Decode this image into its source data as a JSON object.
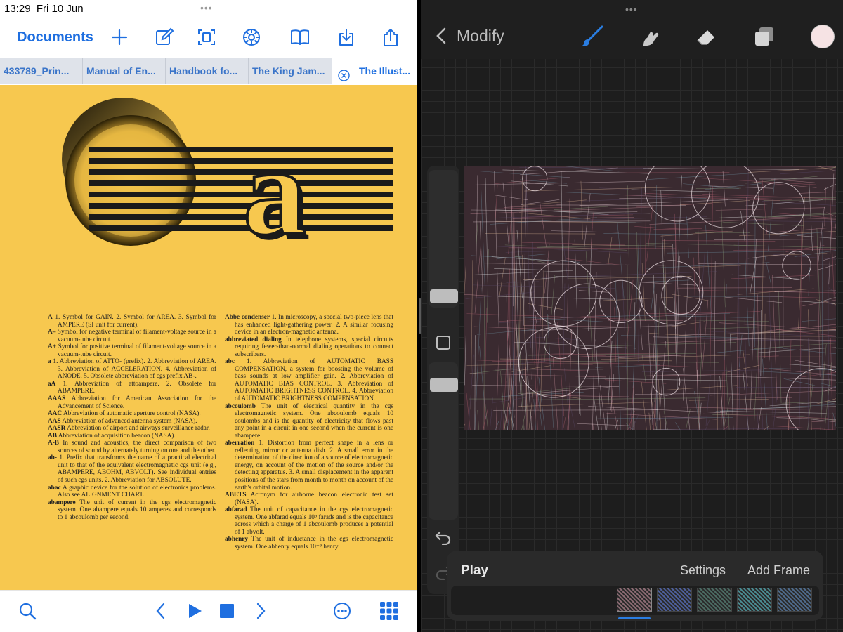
{
  "status": {
    "time": "13:29",
    "date": "Fri 10 Jun",
    "grip": "•••"
  },
  "reader": {
    "toolbar": {
      "documents_label": "Documents",
      "icons": [
        "plus-icon",
        "edit-icon",
        "scan-icon",
        "gear-icon",
        "book-icon",
        "download-icon",
        "share-icon"
      ]
    },
    "tabs": [
      {
        "label": "433789_Prin..."
      },
      {
        "label": "Manual of En..."
      },
      {
        "label": "Handbook fo..."
      },
      {
        "label": "The King Jam..."
      },
      {
        "label": "The Illust...",
        "active": true
      }
    ],
    "page": {
      "big_letter": "a",
      "col1": [
        {
          "term": "A",
          "def": " 1. Symbol for GAIN. 2. Symbol for AREA. 3. Symbol for AMPERE (SI unit for current)."
        },
        {
          "term": "A–",
          "def": " Symbol for negative terminal of filament-voltage source in a vacuum-tube circuit."
        },
        {
          "term": "A+",
          "def": " Symbol for positive terminal of filament-voltage source in a vacuum-tube circuit."
        },
        {
          "term": "a",
          "def": " 1. Abbreviation of ATTO- (prefix). 2. Abbreviation of AREA. 3. Abbreviation of ACCELERATION. 4. Abbreviation of ANODE. 5. Obsolete abbreviation of cgs prefix AB-."
        },
        {
          "term": "aA",
          "def": " 1. Abbreviation of attoampere. 2. Obsolete for ABAMPERE."
        },
        {
          "term": "AAAS",
          "def": " Abbreviation for American Association for the Advancement of Science."
        },
        {
          "term": "AAC",
          "def": " Abbreviation of automatic aperture control (NASA)."
        },
        {
          "term": "AAS",
          "def": " Abbreviation of advanced antenna system (NASA)."
        },
        {
          "term": "AASR",
          "def": " Abbreviation of airport and airways surveillance radar."
        },
        {
          "term": "AB",
          "def": " Abbreviation of acquisition beacon (NASA)."
        },
        {
          "term": "A-B",
          "def": " In sound and acoustics, the direct comparison of two sources of sound by alternately turning on one and the other."
        },
        {
          "term": "ab-",
          "def": " 1. Prefix that transforms the name of a practical electrical unit to that of the equivalent electromagnetic cgs unit (e.g., ABAMPERE, ABOHM, ABVOLT). See individual entries of such cgs units. 2. Abbreviation for ABSOLUTE."
        },
        {
          "term": "abac",
          "def": " A graphic device for the solution of electronics problems. Also see ALIGNMENT CHART."
        },
        {
          "term": "abampere",
          "def": " The unit of current in the cgs electromagnetic system. One abampere equals 10 amperes and corresponds to 1 abcoulomb per second."
        }
      ],
      "col2": [
        {
          "term": "Abbe condenser",
          "def": " 1. In microscopy, a special two-piece lens that has enhanced light-gathering power. 2. A similar focusing device in an electron-magnetic antenna."
        },
        {
          "term": "abbreviated dialing",
          "def": " In telephone systems, special circuits requiring fewer-than-normal dialing operations to connect subscribers."
        },
        {
          "term": "abc",
          "def": " 1. Abbreviation of AUTOMATIC BASS COMPENSATION, a system for boosting the volume of bass sounds at low amplifier gain. 2. Abbreviation of AUTOMATIC BIAS CONTROL. 3. Abbreviation of AUTOMATIC BRIGHTNESS CONTROL. 4. Abbreviation of AUTOMATIC BRIGHTNESS COMPENSATION."
        },
        {
          "term": "abcoulomb",
          "def": " The unit of electrical quantity in the cgs electromagnetic system. One abcoulomb equals 10 coulombs and is the quantity of electricity that flows past any point in a circuit in one second when the current is one abampere."
        },
        {
          "term": "aberration",
          "def": " 1. Distortion from perfect shape in a lens or reflecting mirror or antenna dish. 2. A small error in the determination of the direction of a source of electromagnetic energy, on account of the motion of the source and/or the detecting apparatus. 3. A small displacement in the apparent positions of the stars from month to month on account of the earth's orbital motion."
        },
        {
          "term": "ABETS",
          "def": " Acronym for airborne beacon electronic test set (NASA)."
        },
        {
          "term": "abfarad",
          "def": " The unit of capacitance in the cgs electromagnetic system. One abfarad equals 10⁹ farads and is the capacitance across which a charge of 1 abcoulomb produces a potential of 1 abvolt."
        },
        {
          "term": "abhenry",
          "def": " The unit of inductance in the cgs electromagnetic system. One abhenry equals 10⁻⁹ henry"
        }
      ]
    },
    "bottom": {
      "icons": [
        "search-icon",
        "previous-icon",
        "play-icon",
        "stop-icon",
        "next-icon",
        "more-icon",
        "grid-icon"
      ]
    }
  },
  "procreate": {
    "title": "Modify",
    "tools": [
      "brush-icon",
      "smudge-icon",
      "eraser-icon",
      "layers-icon"
    ],
    "color_swatch": "#f6e3e4",
    "accent": "#2a7de1",
    "animation": {
      "play_label": "Play",
      "settings_label": "Settings",
      "add_frame_label": "Add Frame",
      "frame_count": 5
    }
  }
}
